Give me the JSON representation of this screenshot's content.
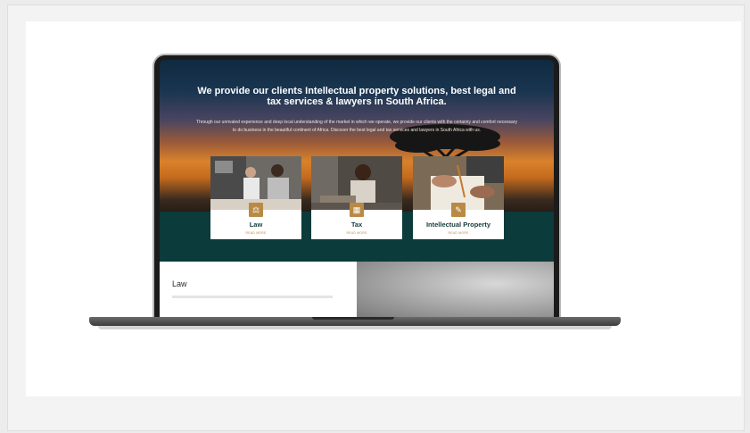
{
  "hero": {
    "title": "We provide our clients Intellectual property solutions, best legal and tax services & lawyers in South Africa.",
    "subtitle": "Through our unrivaled experience and deep local understanding of the market in which we operate, we provide our clients with the certainty and comfort necessary to do business in the beautiful continent of Africa. Discover the best legal and tax services and lawyers in South Africa with us."
  },
  "cards": [
    {
      "title": "Law",
      "more": "READ MORE",
      "icon": "scales-icon"
    },
    {
      "title": "Tax",
      "more": "READ MORE",
      "icon": "calculator-icon"
    },
    {
      "title": "Intellectual Property",
      "more": "READ MORE",
      "icon": "bulb-icon"
    }
  ],
  "section": {
    "title": "Law"
  },
  "colors": {
    "band": "#0b3b3b",
    "accent": "#b98a45",
    "card_title": "#163b3b"
  }
}
